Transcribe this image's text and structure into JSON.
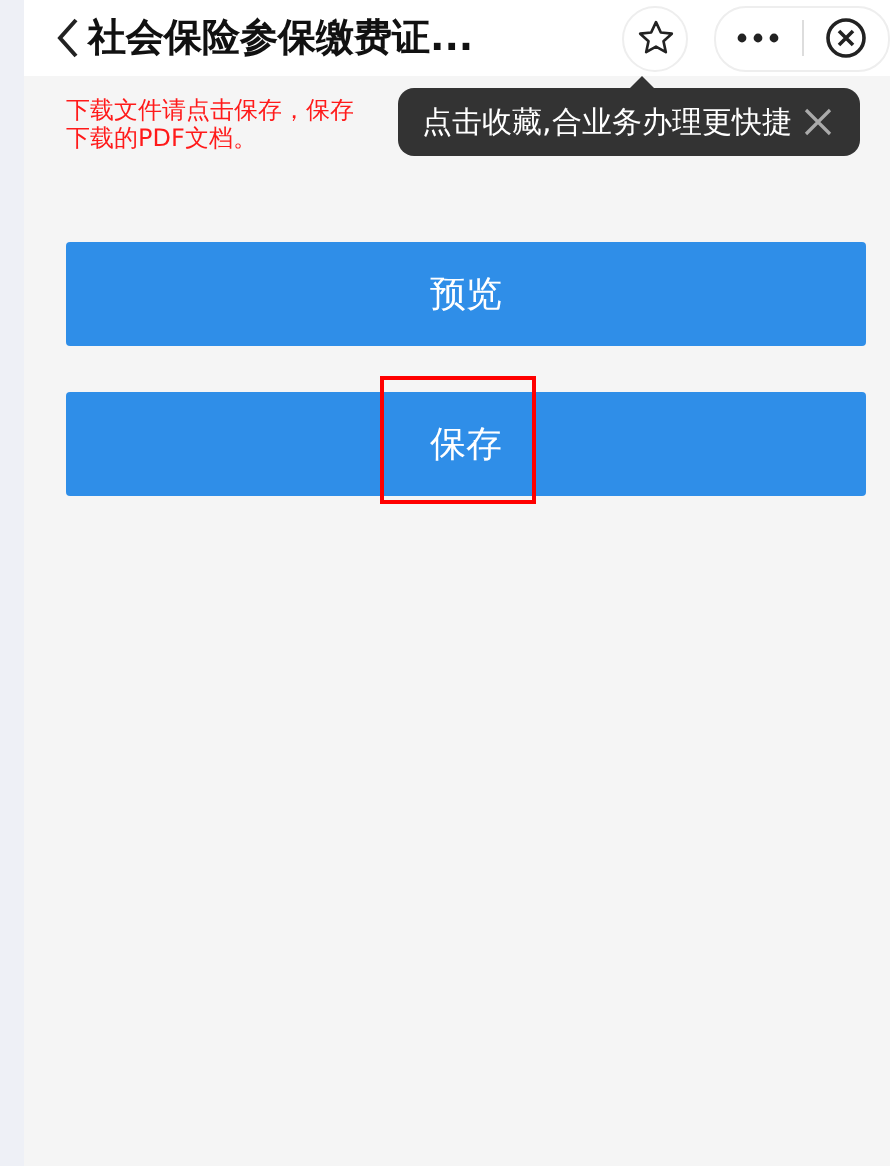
{
  "header": {
    "title": "社会保险参保缴费证..."
  },
  "notice": {
    "lines": [
      "下载文件请点击保存，保存",
      "下载的PDF文档。"
    ]
  },
  "tooltip": {
    "text": "点击收藏,合业务办理更快捷"
  },
  "buttons": [
    {
      "label": "预览",
      "highlighted": false
    },
    {
      "label": "保存",
      "highlighted": true
    }
  ]
}
